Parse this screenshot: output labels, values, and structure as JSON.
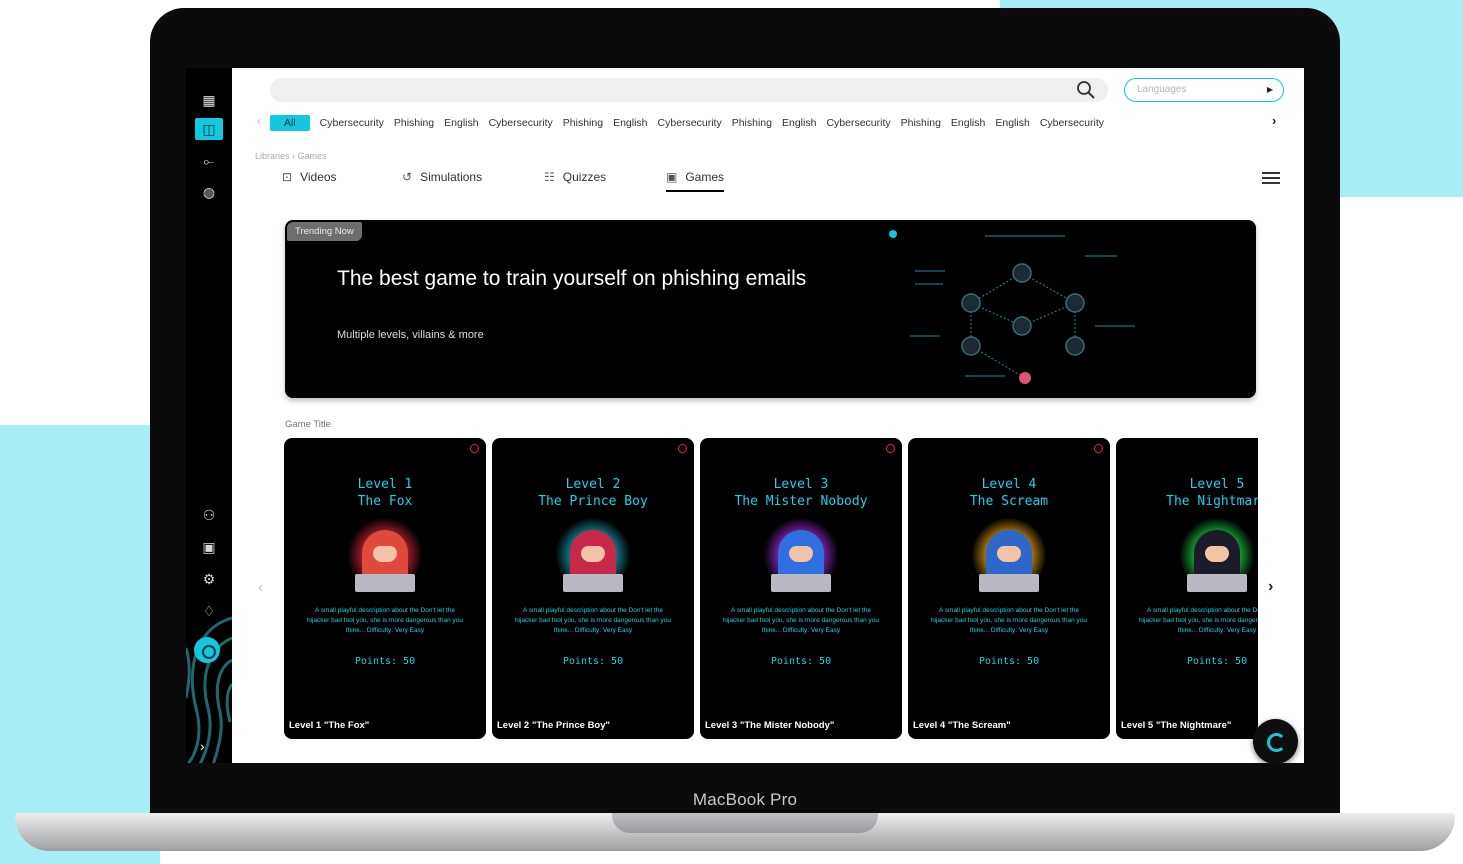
{
  "device_label": "MacBook Pro",
  "search": {
    "placeholder": ""
  },
  "language_select": {
    "placeholder": "Languages"
  },
  "chips": [
    "All",
    "Cybersecurity",
    "Phishing",
    "English",
    "Cybersecurity",
    "Phishing",
    "English",
    "Cybersecurity",
    "Phishing",
    "English",
    "Cybersecurity",
    "Phishing",
    "English",
    "English",
    "Cybersecurity"
  ],
  "breadcrumb": {
    "root": "Libraries",
    "separator": "›",
    "current": "Games"
  },
  "tabs": [
    {
      "label": "Videos",
      "icon": "video-icon"
    },
    {
      "label": "Simulations",
      "icon": "simulations-icon"
    },
    {
      "label": "Quizzes",
      "icon": "quizzes-icon"
    },
    {
      "label": "Games",
      "icon": "games-icon",
      "active": true
    }
  ],
  "hero": {
    "badge": "Trending Now",
    "title": "The best game to train yourself on phishing emails",
    "subtitle": "Multiple levels, villains & more"
  },
  "section_title": "Game Title",
  "colors": {
    "accent": "#14c7de",
    "card_text": "#17d3ea"
  },
  "games": [
    {
      "level": "Level 1",
      "name": "The Fox",
      "points": "Points: 50",
      "caption": "Level 1 \"The Fox\"",
      "glow": "#d12a3a",
      "hood": "#e04a3c",
      "description": "A small playful description about the Don't let the hijacker bad fool you, she is more dangerous than you think... Difficulty: Very Easy"
    },
    {
      "level": "Level 2",
      "name": "The Prince Boy",
      "points": "Points: 50",
      "caption": "Level 2 \"The Prince Boy\"",
      "glow": "#1ea7b8",
      "hood": "#c7294a",
      "description": "A small playful description about the Don't let the hijacker bad fool you, she is more dangerous than you think... Difficulty: Very Easy"
    },
    {
      "level": "Level 3",
      "name": "The Mister Nobody",
      "points": "Points: 50",
      "caption": "Level 3 \"The Mister Nobody\"",
      "glow": "#a42de0",
      "hood": "#2f6fe0",
      "description": "A small playful description about the Don't let the hijacker bad fool you, she is more dangerous than you think... Difficulty: Very Easy"
    },
    {
      "level": "Level 4",
      "name": "The Scream",
      "points": "Points: 50",
      "caption": "Level 4 \"The Scream\"",
      "glow": "#f0a61c",
      "hood": "#2d68c9",
      "description": "A small playful description about the Don't let the hijacker bad fool you, she is more dangerous than you think... Difficulty: Very Easy"
    },
    {
      "level": "Level 5",
      "name": "The Nightmare",
      "points": "Points: 50",
      "caption": "Level 5 \"The Nightmare\"",
      "glow": "#1fd84a",
      "hood": "#1b1b2a",
      "description": "A small playful description about the Don't let the hijacker bad fool you, she is more dangerous than you think... Difficulty: Very Easy"
    }
  ]
}
